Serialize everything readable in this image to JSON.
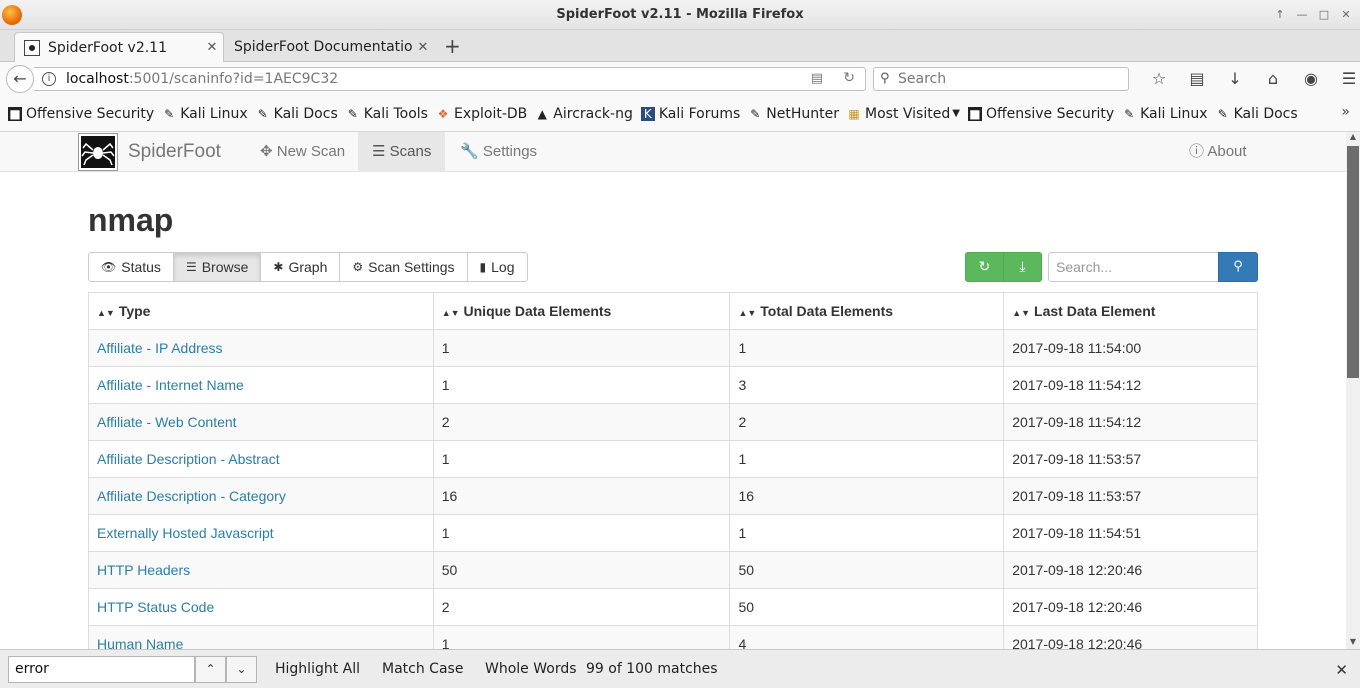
{
  "window": {
    "title": "SpiderFoot v2.11 - Mozilla Firefox"
  },
  "tabs": [
    {
      "label": "SpiderFoot v2.11",
      "active": true
    },
    {
      "label": "SpiderFoot Documentation",
      "active": false
    }
  ],
  "navbar": {
    "url_host": "localhost",
    "url_rest": ":5001/scaninfo?id=1AEC9C32",
    "search_placeholder": "Search"
  },
  "bookmarks": [
    {
      "label": "Offensive Security",
      "icon": "offsec-icon"
    },
    {
      "label": "Kali Linux",
      "icon": "kali-icon"
    },
    {
      "label": "Kali Docs",
      "icon": "kali-icon"
    },
    {
      "label": "Kali Tools",
      "icon": "kali-icon"
    },
    {
      "label": "Exploit-DB",
      "icon": "exploitdb-icon"
    },
    {
      "label": "Aircrack-ng",
      "icon": "aircrack-icon"
    },
    {
      "label": "Kali Forums",
      "icon": "kali-forums-icon"
    },
    {
      "label": "NetHunter",
      "icon": "kali-icon"
    },
    {
      "label": "Most Visited",
      "icon": "folder-icon"
    },
    {
      "label": "Offensive Security",
      "icon": "offsec-icon"
    },
    {
      "label": "Kali Linux",
      "icon": "kali-icon"
    },
    {
      "label": "Kali Docs",
      "icon": "kali-icon"
    }
  ],
  "app": {
    "brand": "SpiderFoot",
    "nav": {
      "new_scan": "New Scan",
      "scans": "Scans",
      "settings": "Settings",
      "about": "About"
    },
    "scan_name": "nmap",
    "tabs": {
      "status": "Status",
      "browse": "Browse",
      "graph": "Graph",
      "scan_settings": "Scan Settings",
      "log": "Log"
    },
    "search_placeholder": "Search...",
    "table": {
      "headers": {
        "type": "Type",
        "unique": "Unique Data Elements",
        "total": "Total Data Elements",
        "last": "Last Data Element"
      },
      "rows": [
        {
          "type": "Affiliate - IP Address",
          "unique": "1",
          "total": "1",
          "last": "2017-09-18 11:54:00"
        },
        {
          "type": "Affiliate - Internet Name",
          "unique": "1",
          "total": "3",
          "last": "2017-09-18 11:54:12"
        },
        {
          "type": "Affiliate - Web Content",
          "unique": "2",
          "total": "2",
          "last": "2017-09-18 11:54:12"
        },
        {
          "type": "Affiliate Description - Abstract",
          "unique": "1",
          "total": "1",
          "last": "2017-09-18 11:53:57"
        },
        {
          "type": "Affiliate Description - Category",
          "unique": "16",
          "total": "16",
          "last": "2017-09-18 11:53:57"
        },
        {
          "type": "Externally Hosted Javascript",
          "unique": "1",
          "total": "1",
          "last": "2017-09-18 11:54:51"
        },
        {
          "type": "HTTP Headers",
          "unique": "50",
          "total": "50",
          "last": "2017-09-18 12:20:46"
        },
        {
          "type": "HTTP Status Code",
          "unique": "2",
          "total": "50",
          "last": "2017-09-18 12:20:46"
        },
        {
          "type": "Human Name",
          "unique": "1",
          "total": "4",
          "last": "2017-09-18 12:20:46"
        }
      ]
    }
  },
  "findbar": {
    "query": "error",
    "highlight_all": "Highlight All",
    "match_case": "Match Case",
    "whole_words": "Whole Words",
    "status": "99 of 100 matches"
  },
  "colors": {
    "link": "#2a7fa8",
    "success": "#5cb85c",
    "primary": "#337ab7"
  }
}
